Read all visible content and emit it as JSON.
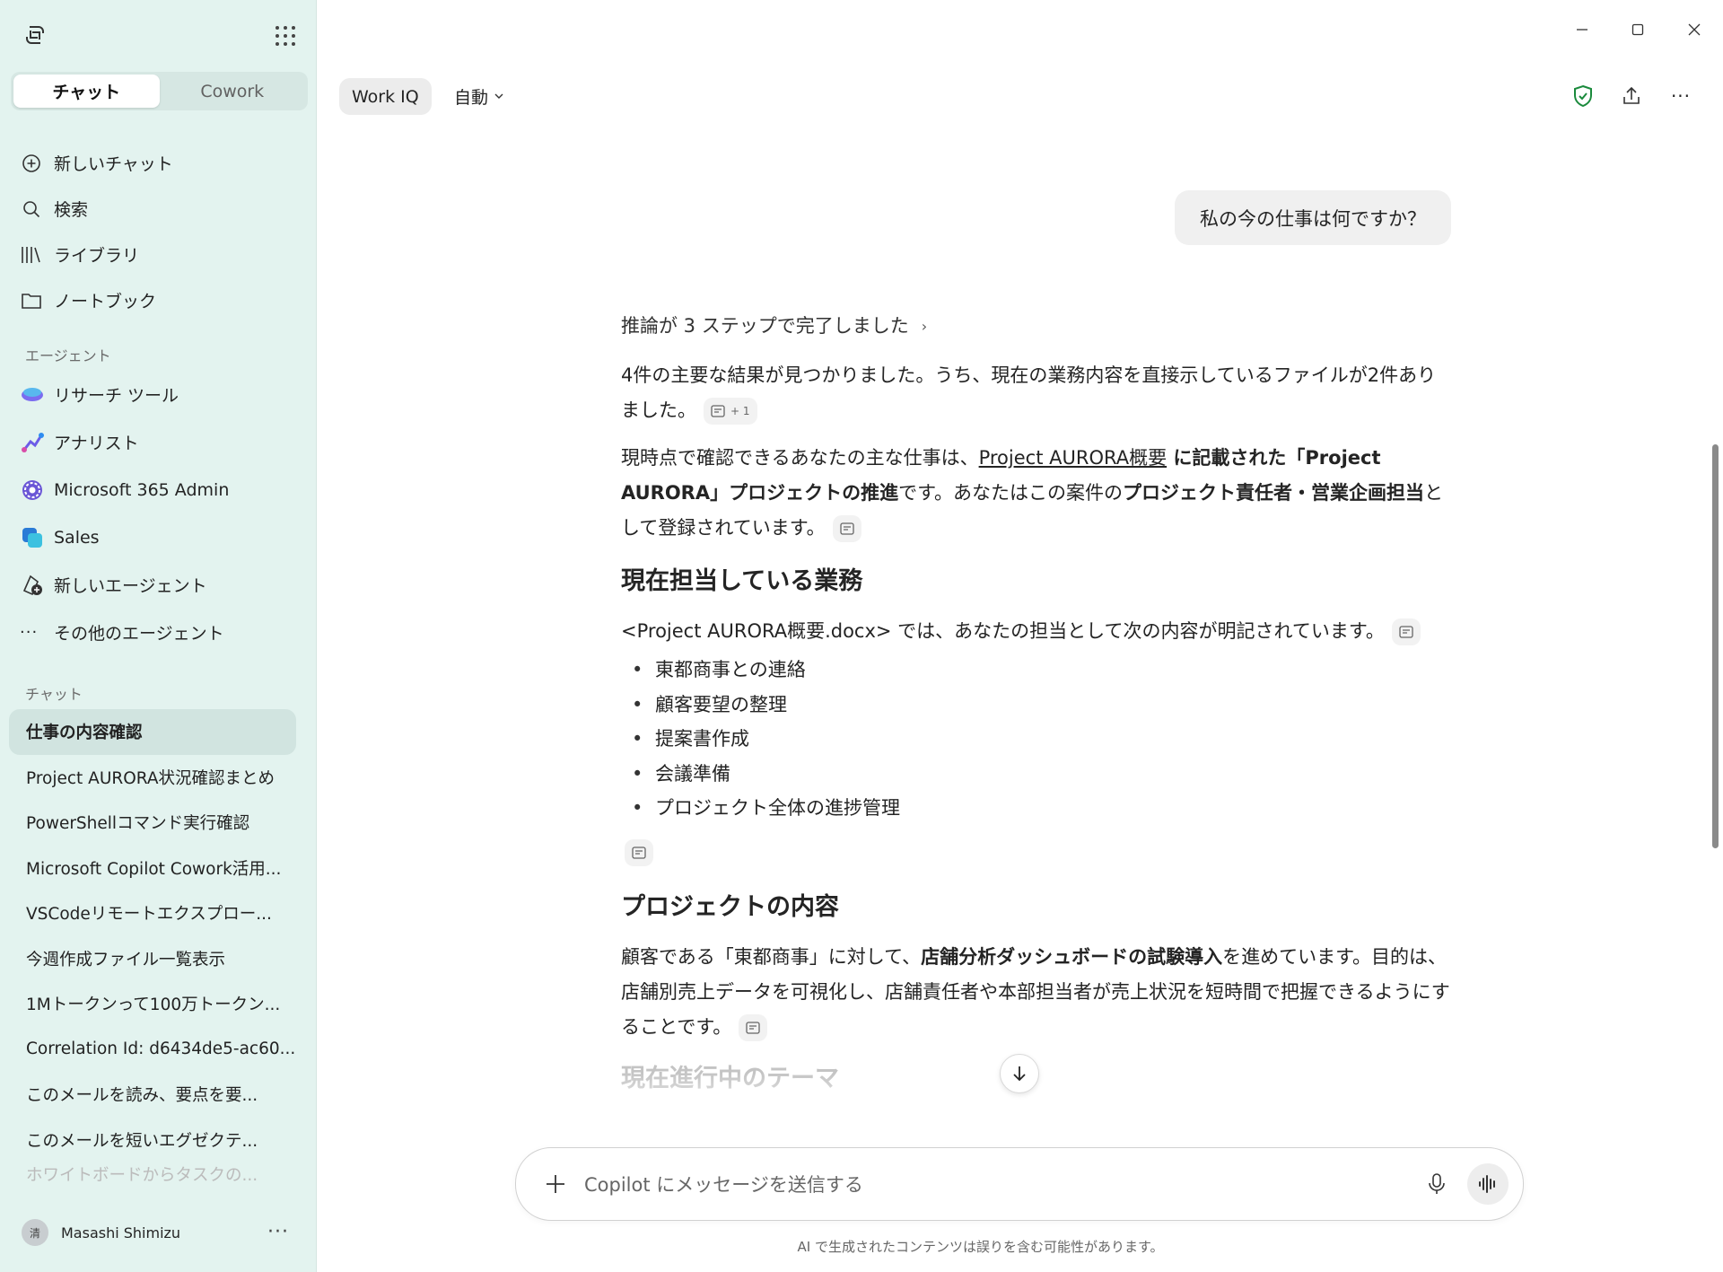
{
  "window": {
    "minimize_icon": "minimize-icon",
    "maximize_icon": "maximize-icon",
    "close_icon": "close-icon"
  },
  "sidebar": {
    "tabs": [
      "チャット",
      "Cowork"
    ],
    "nav": [
      {
        "icon": "add-circle-icon",
        "label": "新しいチャット"
      },
      {
        "icon": "search-icon",
        "label": "検索"
      },
      {
        "icon": "library-icon",
        "label": "ライブラリ"
      },
      {
        "icon": "folder-icon",
        "label": "ノートブック"
      }
    ],
    "agents_heading": "エージェント",
    "agents": [
      {
        "icon": "researcher-icon",
        "label": "リサーチ ツール"
      },
      {
        "icon": "analyst-icon",
        "label": "アナリスト"
      },
      {
        "icon": "gear-icon",
        "label": "Microsoft 365 Admin"
      },
      {
        "icon": "sales-icon",
        "label": "Sales"
      },
      {
        "icon": "new-agent-icon",
        "label": "新しいエージェント"
      },
      {
        "icon": "more-icon",
        "label": "その他のエージェント"
      }
    ],
    "chats_heading": "チャット",
    "chats": [
      "仕事の内容確認",
      "Project AURORA状況確認まとめ",
      "PowerShellコマンド実行確認",
      "Microsoft Copilot Cowork活用...",
      "VSCodeリモートエクスプロー...",
      "今週作成ファイル一覧表示",
      "1Mトークンって100万トークン...",
      "Correlation Id: d6434de5-ac60...",
      "このメールを読み、要点を要...",
      "このメールを短いエグゼクテ...",
      "ホワイトボードからタスクの..."
    ],
    "user": {
      "initial": "清",
      "name": "Masashi Shimizu"
    }
  },
  "toolbar": {
    "work_iq": "Work IQ",
    "mode": "自動",
    "shield_icon": "shield-check-icon",
    "share_icon": "share-icon",
    "more_icon": "more-icon"
  },
  "conversation": {
    "user_message": "私の今の仕事は何ですか？",
    "reasoning": "推論が 3 ステップで完了しました",
    "p1": "4件の主要な結果が見つかりました。うち、現在の業務内容を直接示しているファイルが2件ありました。",
    "p1_cite_extra": "+ 1",
    "p2_a": "現時点で確認できるあなたの主な仕事は、",
    "p2_link": "Project AURORA概要",
    "p2_b": " に記載された「Project AURORA」プロジェクトの推進",
    "p2_c": "です。あなたはこの案件の",
    "p2_d": "プロジェクト責任者・営業企画担当",
    "p2_e": "として登録されています。",
    "h1": "現在担当している業務",
    "p3": "<Project AURORA概要.docx> では、あなたの担当として次の内容が明記されています。",
    "tasks": [
      "東都商事との連絡",
      "顧客要望の整理",
      "提案書作成",
      "会議準備",
      "プロジェクト全体の進捗管理"
    ],
    "h2": "プロジェクトの内容",
    "p4_a": "顧客である「東都商事」に対して、",
    "p4_b": "店舗分析ダッシュボードの試験導入",
    "p4_c": "を進めています。目的は、店舗別売上データを可視化し、店舗責任者や本部担当者が売上状況を短時間で把握できるようにすることです。",
    "h3": "現在進行中のテーマ"
  },
  "composer": {
    "placeholder": "Copilot にメッセージを送信する",
    "disclaimer": "AI で生成されたコンテンツは誤りを含む可能性があります。"
  }
}
